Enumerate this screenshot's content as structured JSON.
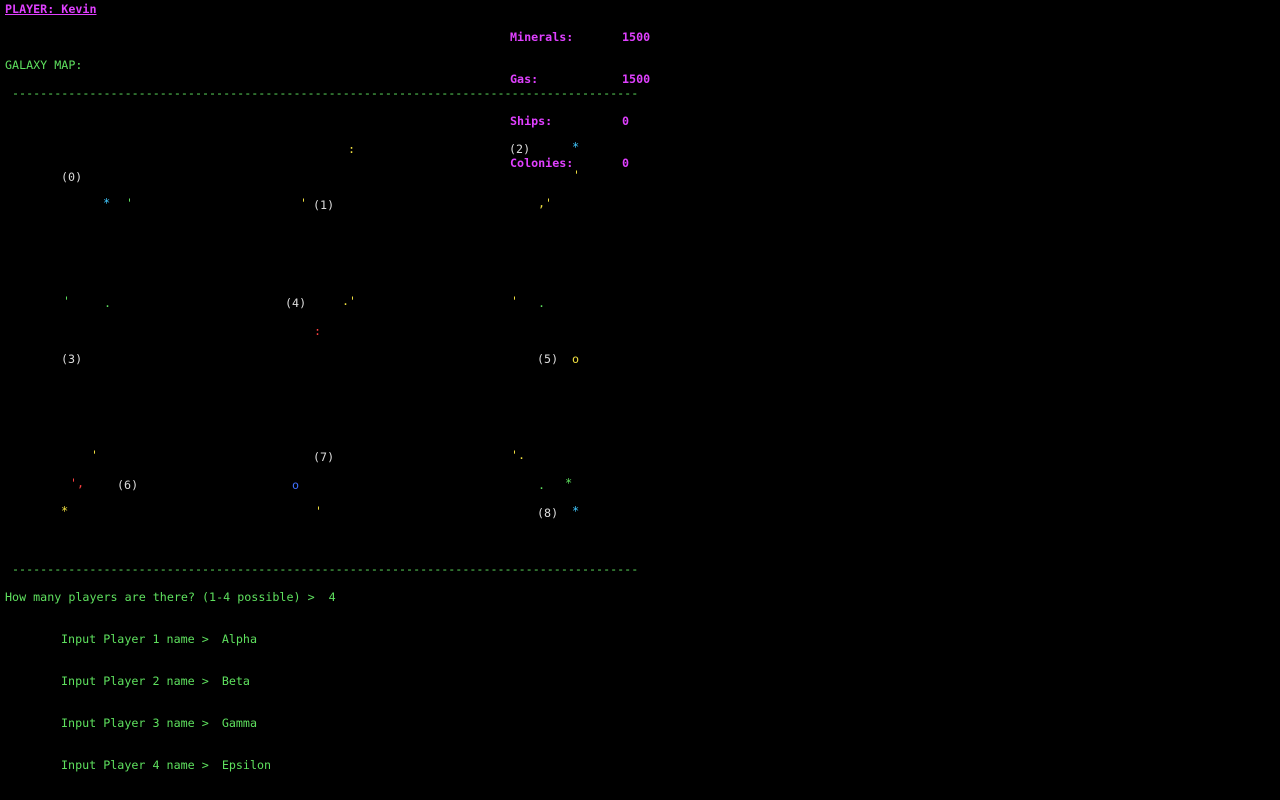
{
  "player": {
    "label": "PLAYER: Kevin"
  },
  "stats": [
    {
      "label": "Minerals:",
      "value": "1500"
    },
    {
      "label": "Gas:",
      "value": "1500"
    },
    {
      "label": "Ships:",
      "value": "0"
    },
    {
      "label": "Colonies:",
      "value": "0"
    }
  ],
  "map": {
    "title": "GALAXY MAP:",
    "divider": "-----------------------------------------------------------------------------------------",
    "planets": [
      "(0)",
      "(1)",
      "(2)",
      "(3)",
      "(4)",
      "(5)",
      "(6)",
      "(7)",
      "(8)"
    ],
    "markers": {
      "m1": ":",
      "m2": "*",
      "m3": "'",
      "m4": "*",
      "m5": "'",
      "m6": "'",
      "m7": ",'",
      "m8": "'",
      "m9": ".",
      "m10": ".'",
      "m11": "'",
      "m12": ".",
      "m13": ":",
      "m14": "o",
      "m15": "'",
      "m16": "'.",
      "m17": "',",
      "m18": "o",
      "m19": ".",
      "m20": "*",
      "m21": "*",
      "m22": "'",
      "m23": "*"
    }
  },
  "console": {
    "prompt": "How many players are there? (1-4 possible) >  4",
    "entries": [
      {
        "label": "Input Player 1 name > ",
        "name": "Alpha"
      },
      {
        "label": "Input Player 2 name > ",
        "name": "Beta"
      },
      {
        "label": "Input Player 3 name > ",
        "name": "Gamma"
      },
      {
        "label": "Input Player 4 name > ",
        "name": "Epsilon"
      }
    ]
  },
  "colors": {
    "background": "#000000",
    "magenta": "#e040ff",
    "green": "#5ee05e",
    "white": "#dcdcdc",
    "cyan": "#40c8ff",
    "yellow": "#f0e040",
    "red": "#ff4040",
    "blue": "#4070ff"
  }
}
